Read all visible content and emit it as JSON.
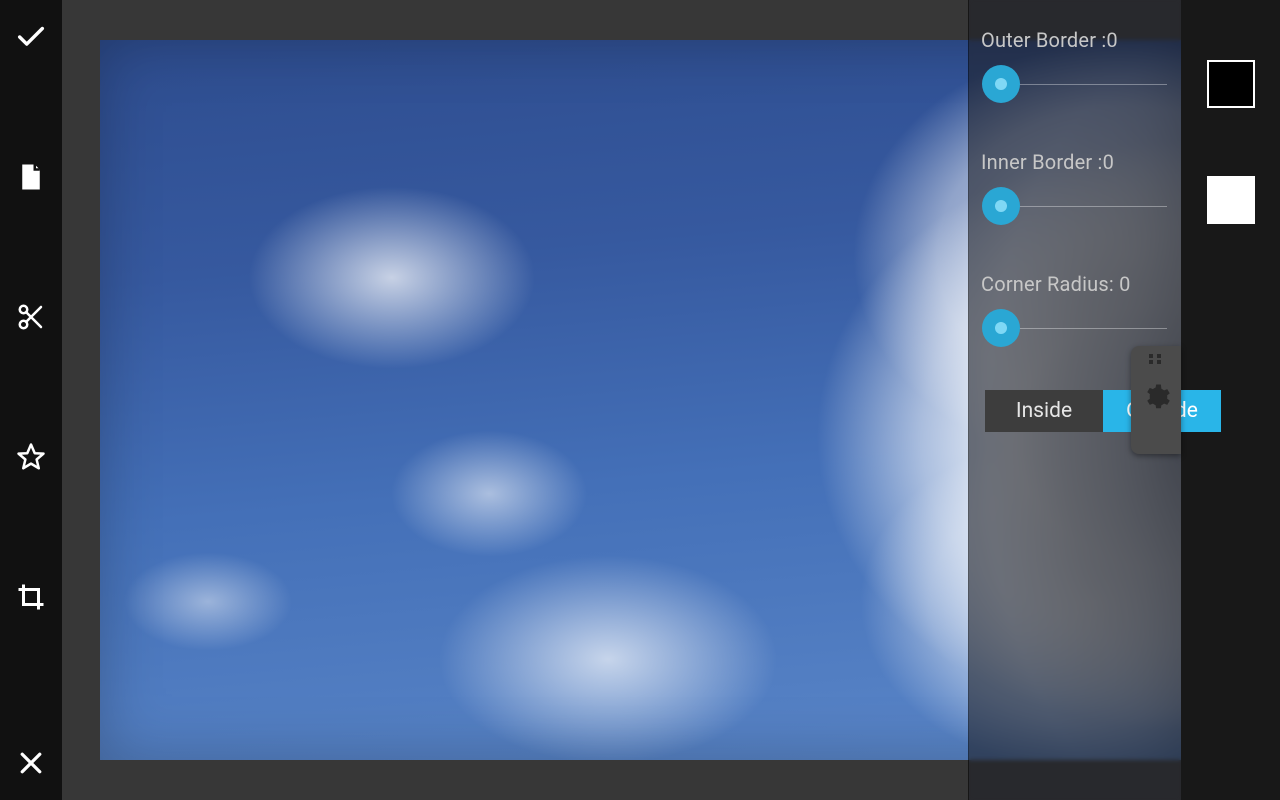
{
  "controls": {
    "outer_border": {
      "label": "Outer Border :0",
      "value": 0
    },
    "inner_border": {
      "label": "Inner Border :0",
      "value": 0
    },
    "corner_radius": {
      "label": "Corner Radius:  0",
      "value": 0
    }
  },
  "toggle": {
    "inside_label": "Inside",
    "outside_label": "Outside",
    "active": "outside"
  },
  "swatches": {
    "top_color": "#000000",
    "bottom_color": "#ffffff"
  },
  "accent_color": "#29b5e8"
}
